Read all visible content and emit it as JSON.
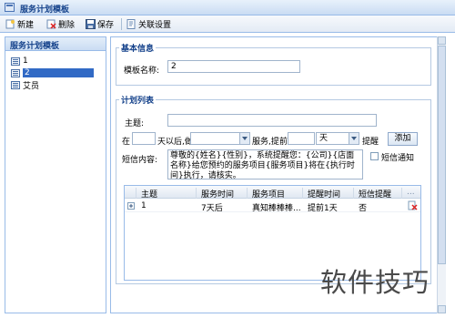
{
  "window": {
    "title": "服务计划模板"
  },
  "toolbar": {
    "new_label": "新建",
    "delete_label": "删除",
    "save_label": "保存",
    "settings_label": "关联设置"
  },
  "sidebar": {
    "header": "服务计划模板",
    "items": [
      {
        "label": "1"
      },
      {
        "label": "2"
      },
      {
        "label": "艾员"
      }
    ]
  },
  "basic_info": {
    "legend": "基本信息",
    "name_label": "模板名称:",
    "name_value": "2"
  },
  "plan_list": {
    "legend": "计划列表",
    "subject_label": "主题:",
    "subject_value": "",
    "in_label": "在",
    "days_value": "",
    "after_label": "天以后,做",
    "service_value": "",
    "remind_label": "服务,提前",
    "remind_value": "",
    "unit_value": "天",
    "remind_suffix": "提醒",
    "add_button": "添加",
    "sms_label": "短信内容:",
    "sms_text": "尊敬的{姓名}{性别}，系统提醒您：{公司}{店面名称}给您预约的服务项目{服务项目}将在{执行时间}执行，请核实。",
    "sms_notify_label": "短信通知"
  },
  "grid": {
    "columns": [
      "主题",
      "服务时间",
      "服务项目",
      "提醒时间",
      "短信提醒",
      "..."
    ],
    "rows": [
      {
        "subject": "1",
        "service_time": "7天后",
        "service_item": "真知棒棒棒...",
        "remind_time": "提前1天",
        "sms_remind": "否"
      }
    ]
  },
  "watermark": "软件技巧",
  "colors": {
    "accent": "#15428b",
    "border": "#99bbe8",
    "selection": "#316ac5"
  }
}
